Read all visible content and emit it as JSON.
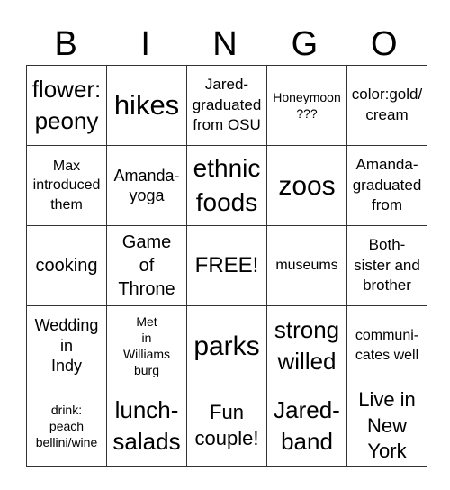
{
  "header": {
    "letters": [
      "B",
      "I",
      "N",
      "G",
      "O"
    ]
  },
  "grid": {
    "rows": [
      [
        "flower:\npeony",
        "hikes",
        "Jared-\ngraduated\nfrom OSU",
        "Honeymoon\n???",
        "color:gold/\ncream"
      ],
      [
        "Max\nintroduced\nthem",
        "Amanda-\nyoga",
        "ethnic\nfoods",
        "zoos",
        "Amanda-\ngraduated\nfrom"
      ],
      [
        "cooking",
        "Game\nof\nThrone",
        "FREE!",
        "museums",
        "Both-\nsister and\nbrother"
      ],
      [
        "Wedding\nin\nIndy",
        "Met\nin\nWilliams\nburg",
        "parks",
        "strong\nwilled",
        "communi-\ncates well"
      ],
      [
        "drink:\npeach\nbellini/wine",
        "lunch-\nsalads",
        "Fun\ncouple!",
        "Jared-\nband",
        "Live in\nNew\nYork"
      ]
    ]
  }
}
